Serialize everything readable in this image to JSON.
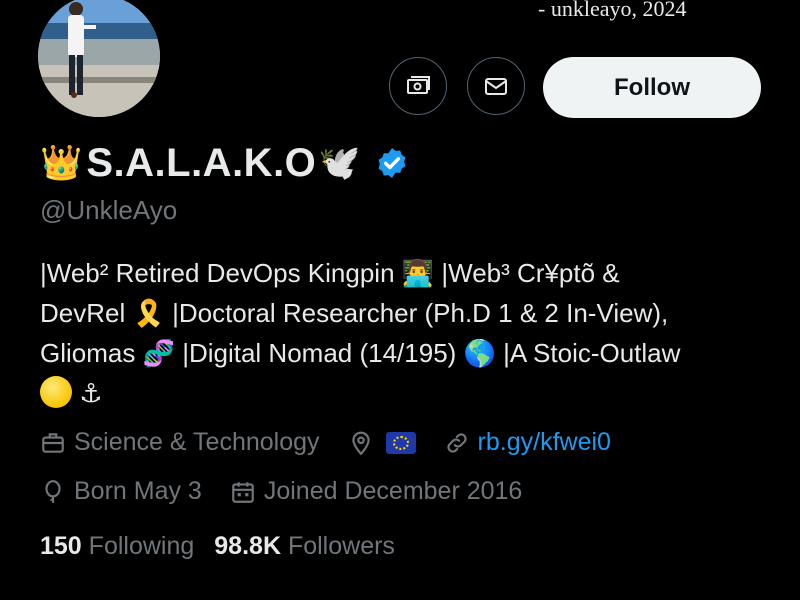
{
  "banner": {
    "caption": "- unkleayo, 2024"
  },
  "profile": {
    "name": "S.A.L.A.K.O",
    "name_prefix_emoji": "👑",
    "name_suffix_emoji": "🕊️",
    "handle": "@UnkleAyo",
    "verified": true
  },
  "actions": {
    "follow_label": "Follow",
    "subscribe_icon": "money-icon",
    "message_icon": "mail-icon"
  },
  "bio": {
    "line1": "|Web² Retired DevOps Kingpin",
    "line1_emoji": "👨‍💻",
    "line1_rest": "|Web³ Cr¥ptõ &",
    "line2": "DevRel",
    "line2_emoji": "🎗️",
    "line2_rest": "|Doctoral Researcher (Ph.D 1 & 2 In-View),",
    "line3": "Gliomas",
    "line3_emoji": "🧬",
    "line3_mid": "|Digital Nomad (14/195)",
    "line3_emoji2": "🌎",
    "line3_rest": "|A Stoic-Outlaw",
    "line4_emoji": "⚓"
  },
  "meta": {
    "category": "Science & Technology",
    "link": "rb.gy/kfwei0",
    "born": "Born May 3",
    "joined": "Joined December 2016"
  },
  "stats": {
    "following_count": "150",
    "following_label": "Following",
    "followers_count": "98.8K",
    "followers_label": "Followers"
  },
  "colors": {
    "background": "#000000",
    "text": "#e7e9ea",
    "muted": "#71767b",
    "accent": "#1d9bf0",
    "follow_bg": "#eff3f4"
  }
}
